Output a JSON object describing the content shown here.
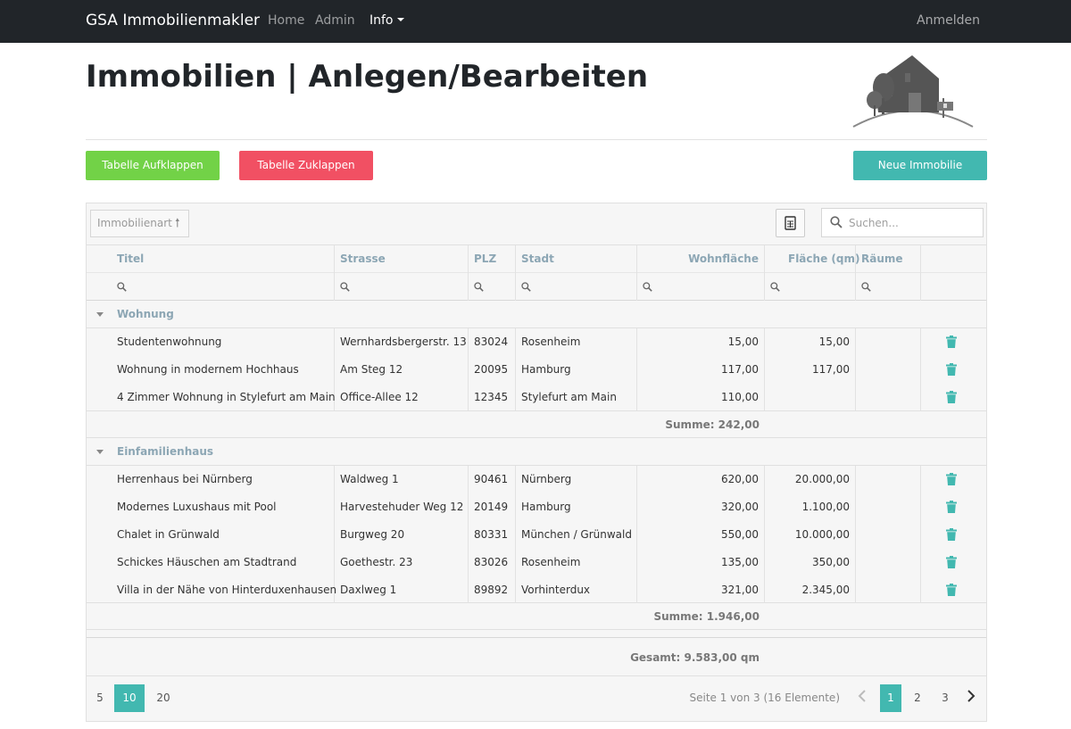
{
  "nav": {
    "brand": "GSA Immobilienmakler",
    "home": "Home",
    "admin": "Admin",
    "info": "Info",
    "login": "Anmelden"
  },
  "page": {
    "title": "Immobilien | Anlegen/Bearbeiten"
  },
  "buttons": {
    "expand": "Tabelle Aufklappen",
    "collapse": "Tabelle Zuklappen",
    "new": "Neue Immobilie"
  },
  "toolbar": {
    "group_chip": "Immobilienart",
    "search_placeholder": "Suchen..."
  },
  "columns": {
    "titel": "Titel",
    "strasse": "Strasse",
    "plz": "PLZ",
    "stadt": "Stadt",
    "wohnflaeche": "Wohnfläche",
    "flaeche": "Fläche (qm)",
    "raeume": "Räume"
  },
  "groups": [
    {
      "name": "Wohnung",
      "summary": "Summe: 242,00",
      "rows": [
        {
          "titel": "Studentenwohnung",
          "strasse": "Wernhardsbergerstr. 13",
          "plz": "83024",
          "stadt": "Rosenheim",
          "wohnflaeche": "15,00",
          "flaeche": "15,00",
          "raeume": ""
        },
        {
          "titel": "Wohnung in modernem Hochhaus",
          "strasse": "Am Steg 12",
          "plz": "20095",
          "stadt": "Hamburg",
          "wohnflaeche": "117,00",
          "flaeche": "117,00",
          "raeume": ""
        },
        {
          "titel": "4 Zimmer Wohnung in Stylefurt am Main",
          "strasse": "Office-Allee 12",
          "plz": "12345",
          "stadt": "Stylefurt am Main",
          "wohnflaeche": "110,00",
          "flaeche": "",
          "raeume": ""
        }
      ]
    },
    {
      "name": "Einfamilienhaus",
      "summary": "Summe: 1.946,00",
      "rows": [
        {
          "titel": "Herrenhaus bei Nürnberg",
          "strasse": "Waldweg 1",
          "plz": "90461",
          "stadt": "Nürnberg",
          "wohnflaeche": "620,00",
          "flaeche": "20.000,00",
          "raeume": ""
        },
        {
          "titel": "Modernes Luxushaus mit Pool",
          "strasse": "Harvestehuder Weg 12",
          "plz": "20149",
          "stadt": "Hamburg",
          "wohnflaeche": "320,00",
          "flaeche": "1.100,00",
          "raeume": ""
        },
        {
          "titel": "Chalet in Grünwald",
          "strasse": "Burgweg 20",
          "plz": "80331",
          "stadt": "München / Grünwald",
          "wohnflaeche": "550,00",
          "flaeche": "10.000,00",
          "raeume": ""
        },
        {
          "titel": "Schickes Häuschen am Stadtrand",
          "strasse": "Goethestr. 23",
          "plz": "83026",
          "stadt": "Rosenheim",
          "wohnflaeche": "135,00",
          "flaeche": "350,00",
          "raeume": ""
        },
        {
          "titel": "Villa in der Nähe von Hinterduxenhausen",
          "strasse": "Daxlweg 1",
          "plz": "89892",
          "stadt": "Vorhinterdux",
          "wohnflaeche": "321,00",
          "flaeche": "2.345,00",
          "raeume": ""
        }
      ]
    }
  ],
  "total": "Gesamt: 9.583,00 qm",
  "pager": {
    "sizes": [
      "5",
      "10",
      "20"
    ],
    "active_size": "10",
    "info": "Seite 1 von 3 (16 Elemente)",
    "pages": [
      "1",
      "2",
      "3"
    ],
    "active_page": "1"
  },
  "colors": {
    "accent": "#42b8b0",
    "expand": "#72d247",
    "collapse": "#f15063",
    "header_text": "#8ca6b4",
    "navbar": "#212529"
  }
}
